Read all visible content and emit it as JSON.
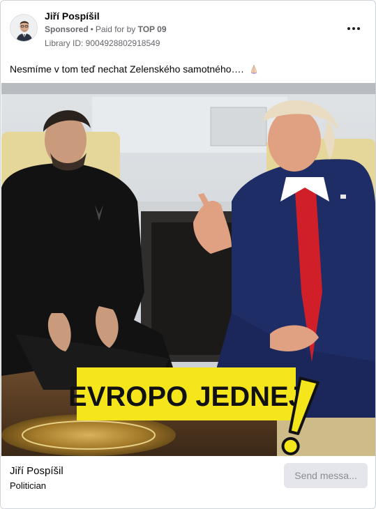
{
  "post": {
    "author": "Jiří Pospíšil",
    "sponsored": "Sponsored",
    "paid_for_prefix": "Paid for by",
    "paid_for_by": "TOP 09",
    "library_id": "Library ID: 9004928802918549",
    "text": "Nesmíme v tom teď nechat Zelenského samotného….",
    "text_emoji": "pray-icon"
  },
  "media": {
    "banner_text": "EVROPO JEDNEJ",
    "banner_color": "#f5e61b",
    "icon": "exclamation-icon"
  },
  "footer": {
    "name": "Jiří Pospíšil",
    "subtitle": "Politician",
    "cta_label": "Send messa..."
  },
  "icons": {
    "more": "more-options-icon",
    "avatar": "avatar"
  }
}
